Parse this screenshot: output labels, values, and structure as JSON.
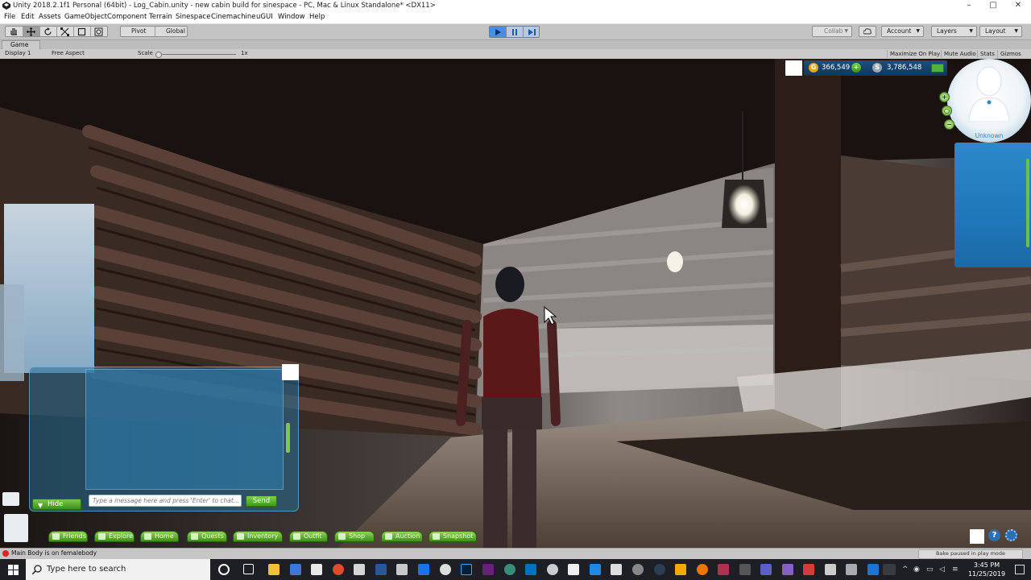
{
  "window": {
    "title": "Unity 2018.2.1f1 Personal (64bit) - Log_Cabin.unity - new cabin build for sinespace - PC, Mac & Linux Standalone* <DX11>",
    "controls": [
      "–",
      "□",
      "✕"
    ]
  },
  "menu": [
    "File",
    "Edit",
    "Assets",
    "GameObject",
    "Component",
    "Terrain",
    "Sinespace",
    "Cinemachine",
    "uGUI",
    "Window",
    "Help"
  ],
  "toolbar": {
    "tools": [
      "hand-tool",
      "move-tool",
      "rotate-tool",
      "scale-tool",
      "rect-tool",
      "transform-tool"
    ],
    "pivot": "Pivot",
    "global": "Global",
    "collab": "Collab",
    "account": "Account",
    "layers": "Layers",
    "layout": "Layout"
  },
  "game_tab": {
    "tab": "Game",
    "display": "Display 1",
    "aspect": "Free Aspect",
    "scale_label": "Scale",
    "scale_value": "1x",
    "maximize": "Maximize On Play",
    "mute": "Mute Audio",
    "stats": "Stats",
    "gizmos": "Gizmos"
  },
  "hud": {
    "gold": "366,549",
    "silver": "3,786,548",
    "gold_symbol": "G",
    "silver_symbol": "S",
    "profile_name": "Unknown",
    "chat_placeholder": "Type a message here and press 'Enter' to chat...",
    "send": "Send",
    "hide": "Hide",
    "nav": [
      "Friends",
      "Explore",
      "Home",
      "Quests",
      "Inventory",
      "Outfit",
      "Shop",
      "Auction",
      "Snapshot"
    ],
    "help": "?"
  },
  "status": {
    "message": "Main Body is on femalebody",
    "bake": "Bake paused in play mode"
  },
  "taskbar": {
    "search_placeholder": "Type here to search",
    "time": "3:45 PM",
    "date": "11/25/2019"
  },
  "colors": {
    "unity_toolbar": "#c3c3c3",
    "play_active": "#4a8de6",
    "hud_green": "#5aa02a",
    "hud_blue": "#1f78b8",
    "taskbar": "#1e1f24"
  }
}
